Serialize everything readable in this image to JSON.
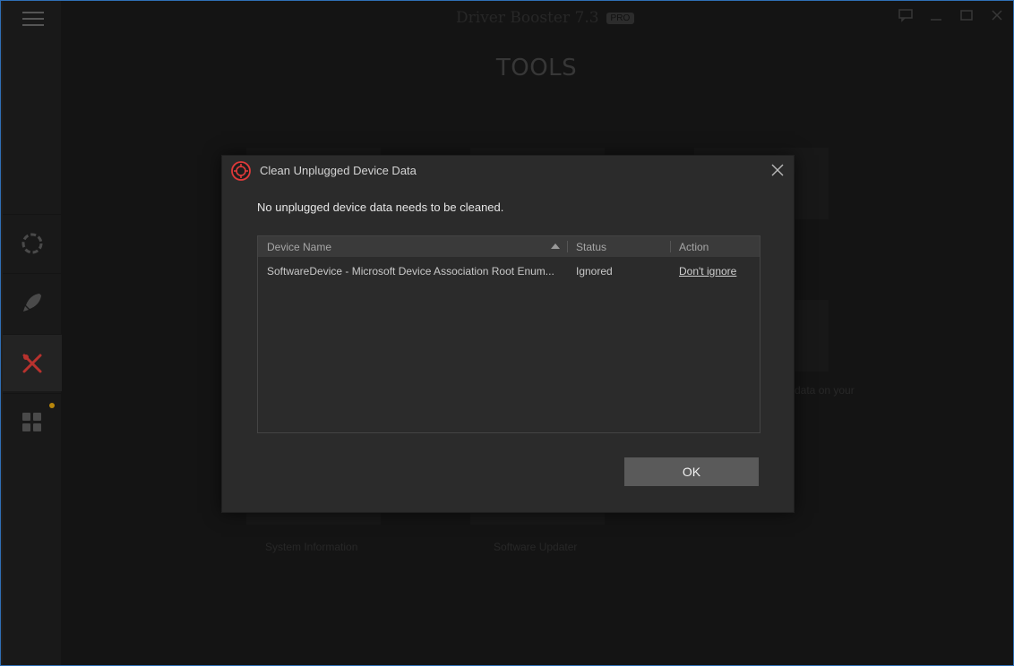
{
  "app": {
    "title": "Driver Booster 7.3",
    "badge": "PRO",
    "page_title": "TOOLS"
  },
  "sidebar": {
    "items": [
      {
        "icon": "scan-icon"
      },
      {
        "icon": "rocket-icon"
      },
      {
        "icon": "tools-icon",
        "active": true
      },
      {
        "icon": "apps-icon",
        "notification": true
      }
    ]
  },
  "background_tools": {
    "labels": [
      "System Information",
      "Software Updater"
    ],
    "partial_texts": [
      "r",
      "data on your"
    ]
  },
  "dialog": {
    "title": "Clean Unplugged Device Data",
    "message": "No unplugged device data needs to be cleaned.",
    "table": {
      "columns": [
        "Device Name",
        "Status",
        "Action"
      ],
      "rows": [
        {
          "device_name": "SoftwareDevice - Microsoft Device Association Root Enum...",
          "status": "Ignored",
          "action": "Don't ignore"
        }
      ]
    },
    "ok_label": "OK"
  },
  "colors": {
    "accent_red": "#e03a3a",
    "window_border": "#2f6fb5"
  }
}
